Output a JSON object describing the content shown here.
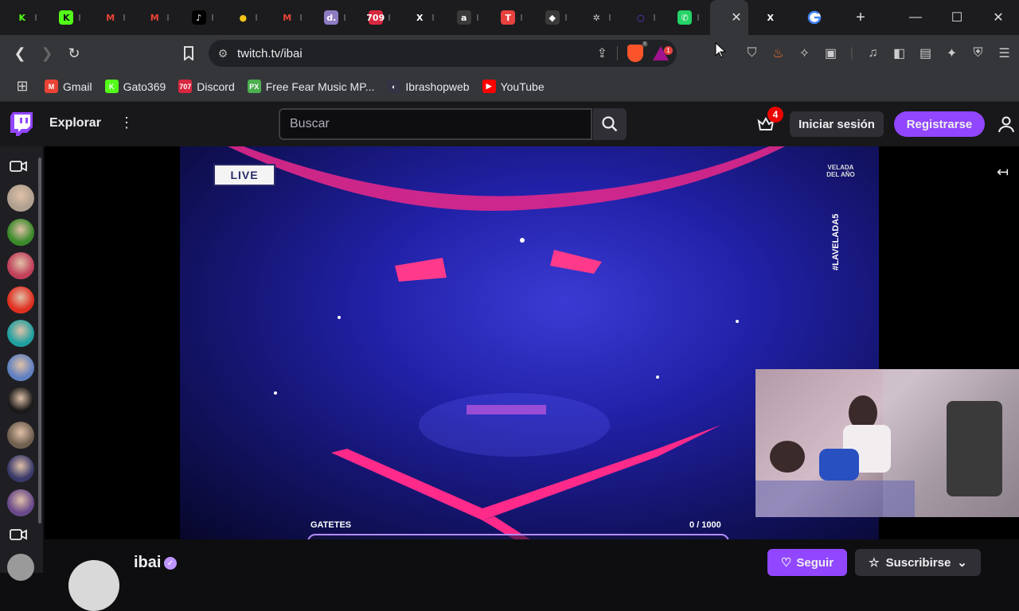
{
  "browser": {
    "tabs": [
      {
        "icon": "kick-icon",
        "glyph": "K",
        "color": "#1a1a1a",
        "fg": "#53fc18"
      },
      {
        "icon": "kick-icon",
        "glyph": "K",
        "color": "#53fc18",
        "fg": "#111"
      },
      {
        "icon": "gmail-icon",
        "glyph": "M",
        "color": "#1c1c1f",
        "fg": "#ea4335"
      },
      {
        "icon": "gmail-icon",
        "glyph": "M",
        "color": "#1c1c1f",
        "fg": "#ea4335"
      },
      {
        "icon": "tiktok-icon",
        "glyph": "♪",
        "color": "#000",
        "fg": "#fff"
      },
      {
        "icon": "circle-icon",
        "glyph": "●",
        "color": "#1c1c1f",
        "fg": "#f5c518"
      },
      {
        "icon": "gmail-icon",
        "glyph": "M",
        "color": "#1c1c1f",
        "fg": "#ea4335"
      },
      {
        "icon": "d-icon",
        "glyph": "d.",
        "color": "#8e7cc3",
        "fg": "#fff"
      },
      {
        "icon": "counter-icon",
        "glyph": "709",
        "color": "#d8283f",
        "fg": "#fff"
      },
      {
        "icon": "x-icon",
        "glyph": "X",
        "color": "#1c1c1f",
        "fg": "#fff"
      },
      {
        "icon": "a-icon",
        "glyph": "a",
        "color": "#3a3a3a",
        "fg": "#fff"
      },
      {
        "icon": "t-icon",
        "glyph": "T",
        "color": "#e8423f",
        "fg": "#fff"
      },
      {
        "icon": "diamond-icon",
        "glyph": "◆",
        "color": "#3a3a3a",
        "fg": "#fff"
      },
      {
        "icon": "openai-icon",
        "glyph": "✲",
        "color": "#1c1c1f",
        "fg": "#ccc"
      },
      {
        "icon": "ring-icon",
        "glyph": "○",
        "color": "#1c1c1f",
        "fg": "#6a3ad8"
      },
      {
        "icon": "whatsapp-icon",
        "glyph": "✆",
        "color": "#25d366",
        "fg": "#fff"
      }
    ],
    "x_tab_glyph": "X",
    "url": "twitch.tv/ibai",
    "brave_badge": "8",
    "rewards_badge": "1",
    "bookmarks": [
      {
        "label": "Gmail",
        "icon": "gmail-icon",
        "glyph": "M",
        "color": "#ea4335"
      },
      {
        "label": "Gato369",
        "icon": "kick-icon",
        "glyph": "K",
        "color": "#53fc18"
      },
      {
        "label": "Discord",
        "icon": "counter-icon",
        "glyph": "707",
        "color": "#d8283f"
      },
      {
        "label": "Free Fear Music MP...",
        "icon": "px-icon",
        "glyph": "PX",
        "color": "#4caf50"
      },
      {
        "label": "Ibrashopweb",
        "icon": "ibrashop-icon",
        "glyph": "◐",
        "color": "#334"
      },
      {
        "label": "YouTube",
        "icon": "youtube-icon",
        "glyph": "▶",
        "color": "#ff0000"
      }
    ]
  },
  "twitch": {
    "explore": "Explorar",
    "search_placeholder": "Buscar",
    "notification_count": "4",
    "login": "Iniciar sesión",
    "signup": "Registrarse"
  },
  "stream": {
    "live_label": "LIVE",
    "event_logo": "VELADA DEL AÑO",
    "hashtag": "#LAVELADA5",
    "goal_label": "GATETES",
    "goal_current": 0,
    "goal_target": 1000,
    "goal_text": "0  / 1000"
  },
  "channel": {
    "name": "ibai",
    "follow": "Seguir",
    "subscribe": "Suscribirse"
  },
  "sidebar": {
    "avatars": [
      "#b0a090",
      "#3a8a2a",
      "#c0405a",
      "#e03020",
      "#20a0a0",
      "#6080c0",
      "#1a1a1a",
      "#706050",
      "#3a3a6a",
      "#6a4a8a"
    ]
  }
}
